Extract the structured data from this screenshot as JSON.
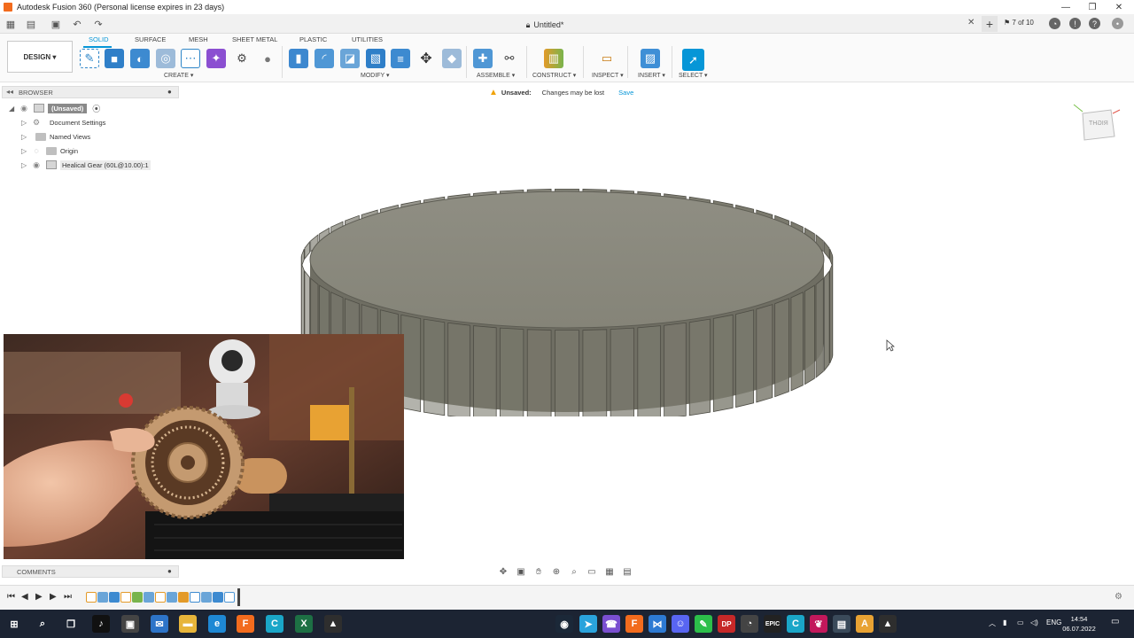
{
  "window": {
    "title": "Autodesk Fusion 360 (Personal license expires in 23 days)",
    "minimize": "—",
    "restore": "❐",
    "close": "✕"
  },
  "tabbar": {
    "document_tab": "Untitled*",
    "job_status": "7 of 10"
  },
  "ribbon": {
    "workspace": "DESIGN",
    "tabs": [
      "SOLID",
      "SURFACE",
      "MESH",
      "SHEET METAL",
      "PLASTIC",
      "UTILITIES"
    ],
    "groups": {
      "create": "CREATE",
      "modify": "MODIFY",
      "assemble": "ASSEMBLE",
      "construct": "CONSTRUCT",
      "inspect": "INSPECT",
      "insert": "INSERT",
      "select": "SELECT"
    }
  },
  "browser": {
    "title": "BROWSER",
    "root": "(Unsaved)",
    "items": [
      {
        "label": "Document Settings"
      },
      {
        "label": "Named Views"
      },
      {
        "label": "Origin"
      },
      {
        "label": "Healical Gear (60L@10.00):1"
      }
    ]
  },
  "notice": {
    "status": "Unsaved:",
    "message": "Changes may be lost",
    "action": "Save"
  },
  "viewcube": {
    "face": "RIGHT"
  },
  "comments": {
    "title": "COMMENTS"
  },
  "taskbar": {
    "language": "ENG",
    "time": "14:54",
    "date": "06.07.2022"
  },
  "colors": {
    "accent": "#0696d7",
    "gear_top": "#8d8c80",
    "gear_side": "#7b7a6e",
    "taskbar": "#1c2433"
  }
}
